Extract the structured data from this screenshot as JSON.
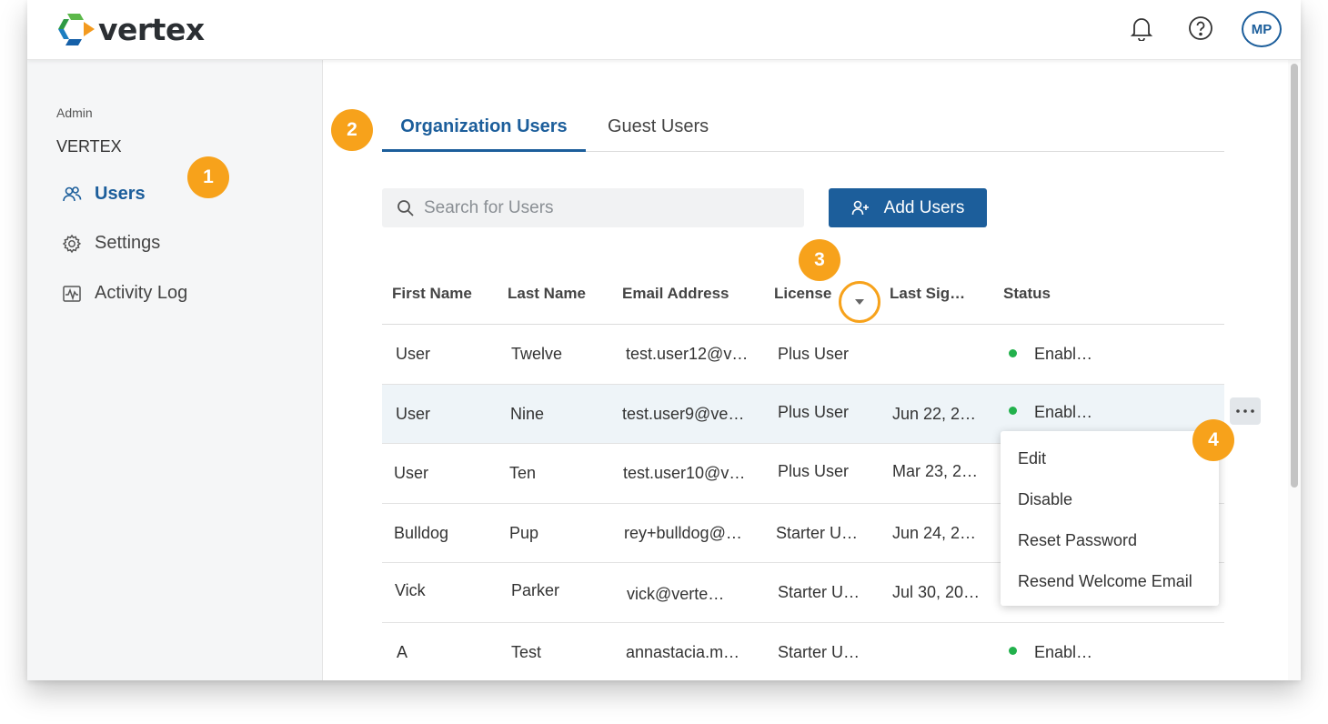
{
  "app": {
    "brand": "vertex",
    "avatar_initials": "MP"
  },
  "sidebar": {
    "section_label": "Admin",
    "org_name": "VERTEX",
    "items": [
      {
        "label": "Users",
        "icon": "users-icon",
        "active": true
      },
      {
        "label": "Settings",
        "icon": "gear-icon",
        "active": false
      },
      {
        "label": "Activity Log",
        "icon": "activity-log-icon",
        "active": false
      }
    ]
  },
  "markers": [
    "1",
    "2",
    "3",
    "4"
  ],
  "tabs": [
    {
      "label": "Organization Users",
      "active": true
    },
    {
      "label": "Guest Users",
      "active": false
    }
  ],
  "search": {
    "placeholder": "Search for Users",
    "value": ""
  },
  "add_button": {
    "label": "Add Users"
  },
  "table": {
    "columns": [
      "First Name",
      "Last Name",
      "Email Address",
      "License",
      "Last Sig…",
      "Status"
    ],
    "rows": [
      {
        "first": "User",
        "last": "Twelve",
        "email": "test.user12@v…",
        "license": "Plus User",
        "last_sign_in": "",
        "status": "Enabl…"
      },
      {
        "first": "User",
        "last": "Nine",
        "email": "test.user9@ve…",
        "license": "Plus User",
        "last_sign_in": "Jun 22, 2…",
        "status": "Enabl…"
      },
      {
        "first": "User",
        "last": "Ten",
        "email": "test.user10@v…",
        "license": "Plus User",
        "last_sign_in": "Mar 23, 2…",
        "status": ""
      },
      {
        "first": "Bulldog",
        "last": "Pup",
        "email": "rey+bulldog@…",
        "license": "Starter U…",
        "last_sign_in": "Jun 24, 2…",
        "status": ""
      },
      {
        "first": "Vick",
        "last": "Parker",
        "email": "vick@verte…",
        "license": "Starter U…",
        "last_sign_in": "Jul 30, 20…",
        "status": ""
      },
      {
        "first": "A",
        "last": "Test",
        "email": "annastacia.m…",
        "license": "Starter U…",
        "last_sign_in": "",
        "status": "Enabl…"
      }
    ]
  },
  "row_menu": {
    "items": [
      "Edit",
      "Disable",
      "Reset Password",
      "Resend Welcome Email"
    ]
  },
  "colors": {
    "accent": "#1c5e9b",
    "marker": "#f7a21b",
    "status_enabled": "#22b14c"
  }
}
